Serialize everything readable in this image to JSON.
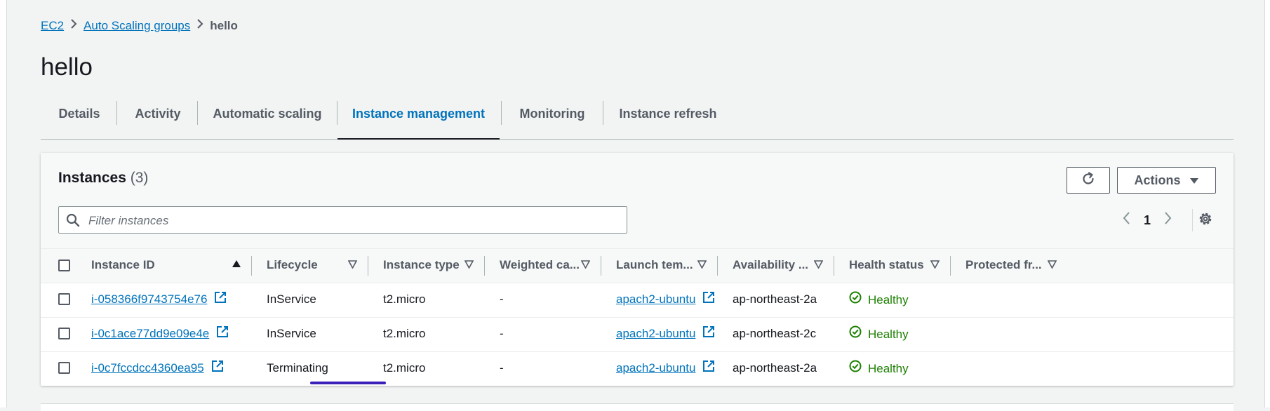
{
  "breadcrumb": {
    "root": "EC2",
    "section": "Auto Scaling groups",
    "current": "hello"
  },
  "page_title": "hello",
  "tabs": [
    {
      "label": "Details"
    },
    {
      "label": "Activity"
    },
    {
      "label": "Automatic scaling"
    },
    {
      "label": "Instance management",
      "active": true
    },
    {
      "label": "Monitoring"
    },
    {
      "label": "Instance refresh"
    }
  ],
  "panel": {
    "title": "Instances",
    "count": "(3)",
    "actions_label": "Actions",
    "refresh_icon": "refresh-icon",
    "filter_placeholder": "Filter instances",
    "page_number": "1"
  },
  "table": {
    "columns": [
      {
        "label": "Instance ID",
        "sort": "ascending"
      },
      {
        "label": "Lifecycle"
      },
      {
        "label": "Instance type"
      },
      {
        "label": "Weighted ca..."
      },
      {
        "label": "Launch tem..."
      },
      {
        "label": "Availability ..."
      },
      {
        "label": "Health status"
      },
      {
        "label": "Protected fr..."
      }
    ],
    "rows": [
      {
        "instance_id": "i-058366f9743754e76",
        "lifecycle": "InService",
        "instance_type": "t2.micro",
        "weighted_capacity": "-",
        "launch_template": "apach2-ubuntu",
        "launch_sep": "|",
        "availability_zone": "ap-northeast-2a",
        "health_status": "Healthy",
        "protected": ""
      },
      {
        "instance_id": "i-0c1ace77dd9e09e4e",
        "lifecycle": "InService",
        "instance_type": "t2.micro",
        "weighted_capacity": "-",
        "launch_template": "apach2-ubuntu",
        "launch_sep": "|",
        "availability_zone": "ap-northeast-2c",
        "health_status": "Healthy",
        "protected": ""
      },
      {
        "instance_id": "i-0c7fccdcc4360ea95",
        "lifecycle": "Terminating",
        "instance_type": "t2.micro",
        "weighted_capacity": "-",
        "launch_template": "apach2-ubuntu",
        "launch_sep": "|",
        "availability_zone": "ap-northeast-2a",
        "health_status": "Healthy",
        "protected": ""
      }
    ]
  },
  "colors": {
    "link": "#0073bb",
    "healthy": "#1d8102",
    "annotation": "#3a1fb8",
    "text": "#16191f",
    "muted": "#545b64"
  }
}
